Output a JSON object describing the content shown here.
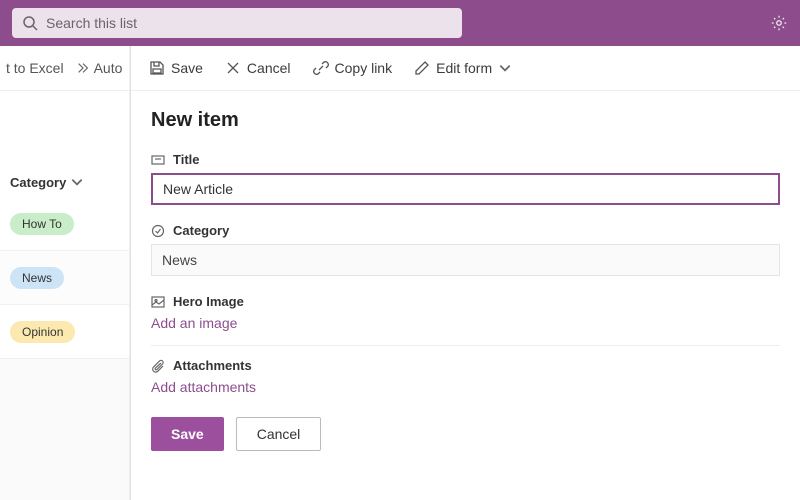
{
  "search": {
    "placeholder": "Search this list"
  },
  "leftCmd": {
    "excel": "t to Excel",
    "automate": "Auto"
  },
  "column": {
    "header": "Category"
  },
  "rows": [
    {
      "label": "How To",
      "pill": "green"
    },
    {
      "label": "News",
      "pill": "blue"
    },
    {
      "label": "Opinion",
      "pill": "yellow"
    }
  ],
  "panel": {
    "toolbar": {
      "save": "Save",
      "cancel": "Cancel",
      "copylink": "Copy link",
      "editform": "Edit form"
    },
    "title": "New item",
    "fields": {
      "title_label": "Title",
      "title_value": "New Article",
      "category_label": "Category",
      "category_value": "News",
      "hero_label": "Hero Image",
      "hero_link": "Add an image",
      "attach_label": "Attachments",
      "attach_link": "Add attachments"
    },
    "buttons": {
      "save": "Save",
      "cancel": "Cancel"
    }
  }
}
